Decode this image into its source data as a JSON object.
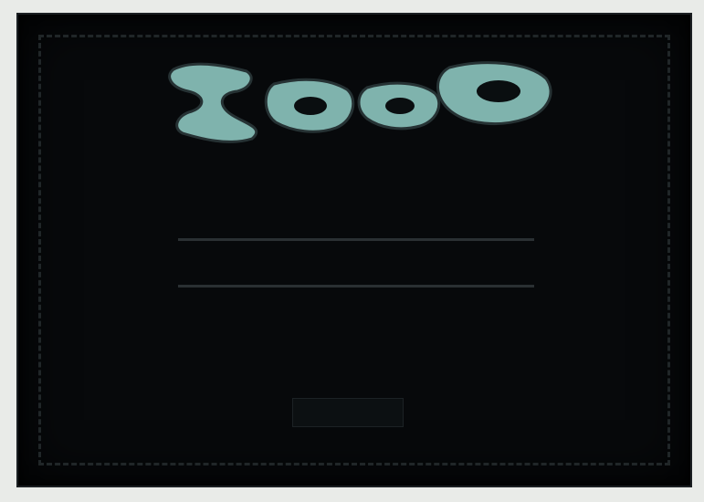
{
  "colors": {
    "background": "#07090b",
    "logo": "#7fb3ad",
    "text": "#9aa2a6"
  },
  "subtitle": {
    "line1": "",
    "line2": ""
  },
  "title": "",
  "menu": [
    {
      "key": "",
      "label": "",
      "value": ""
    },
    {
      "key": "",
      "label": "",
      "value": ""
    }
  ],
  "footer": {
    "line1": "",
    "line2": ""
  }
}
